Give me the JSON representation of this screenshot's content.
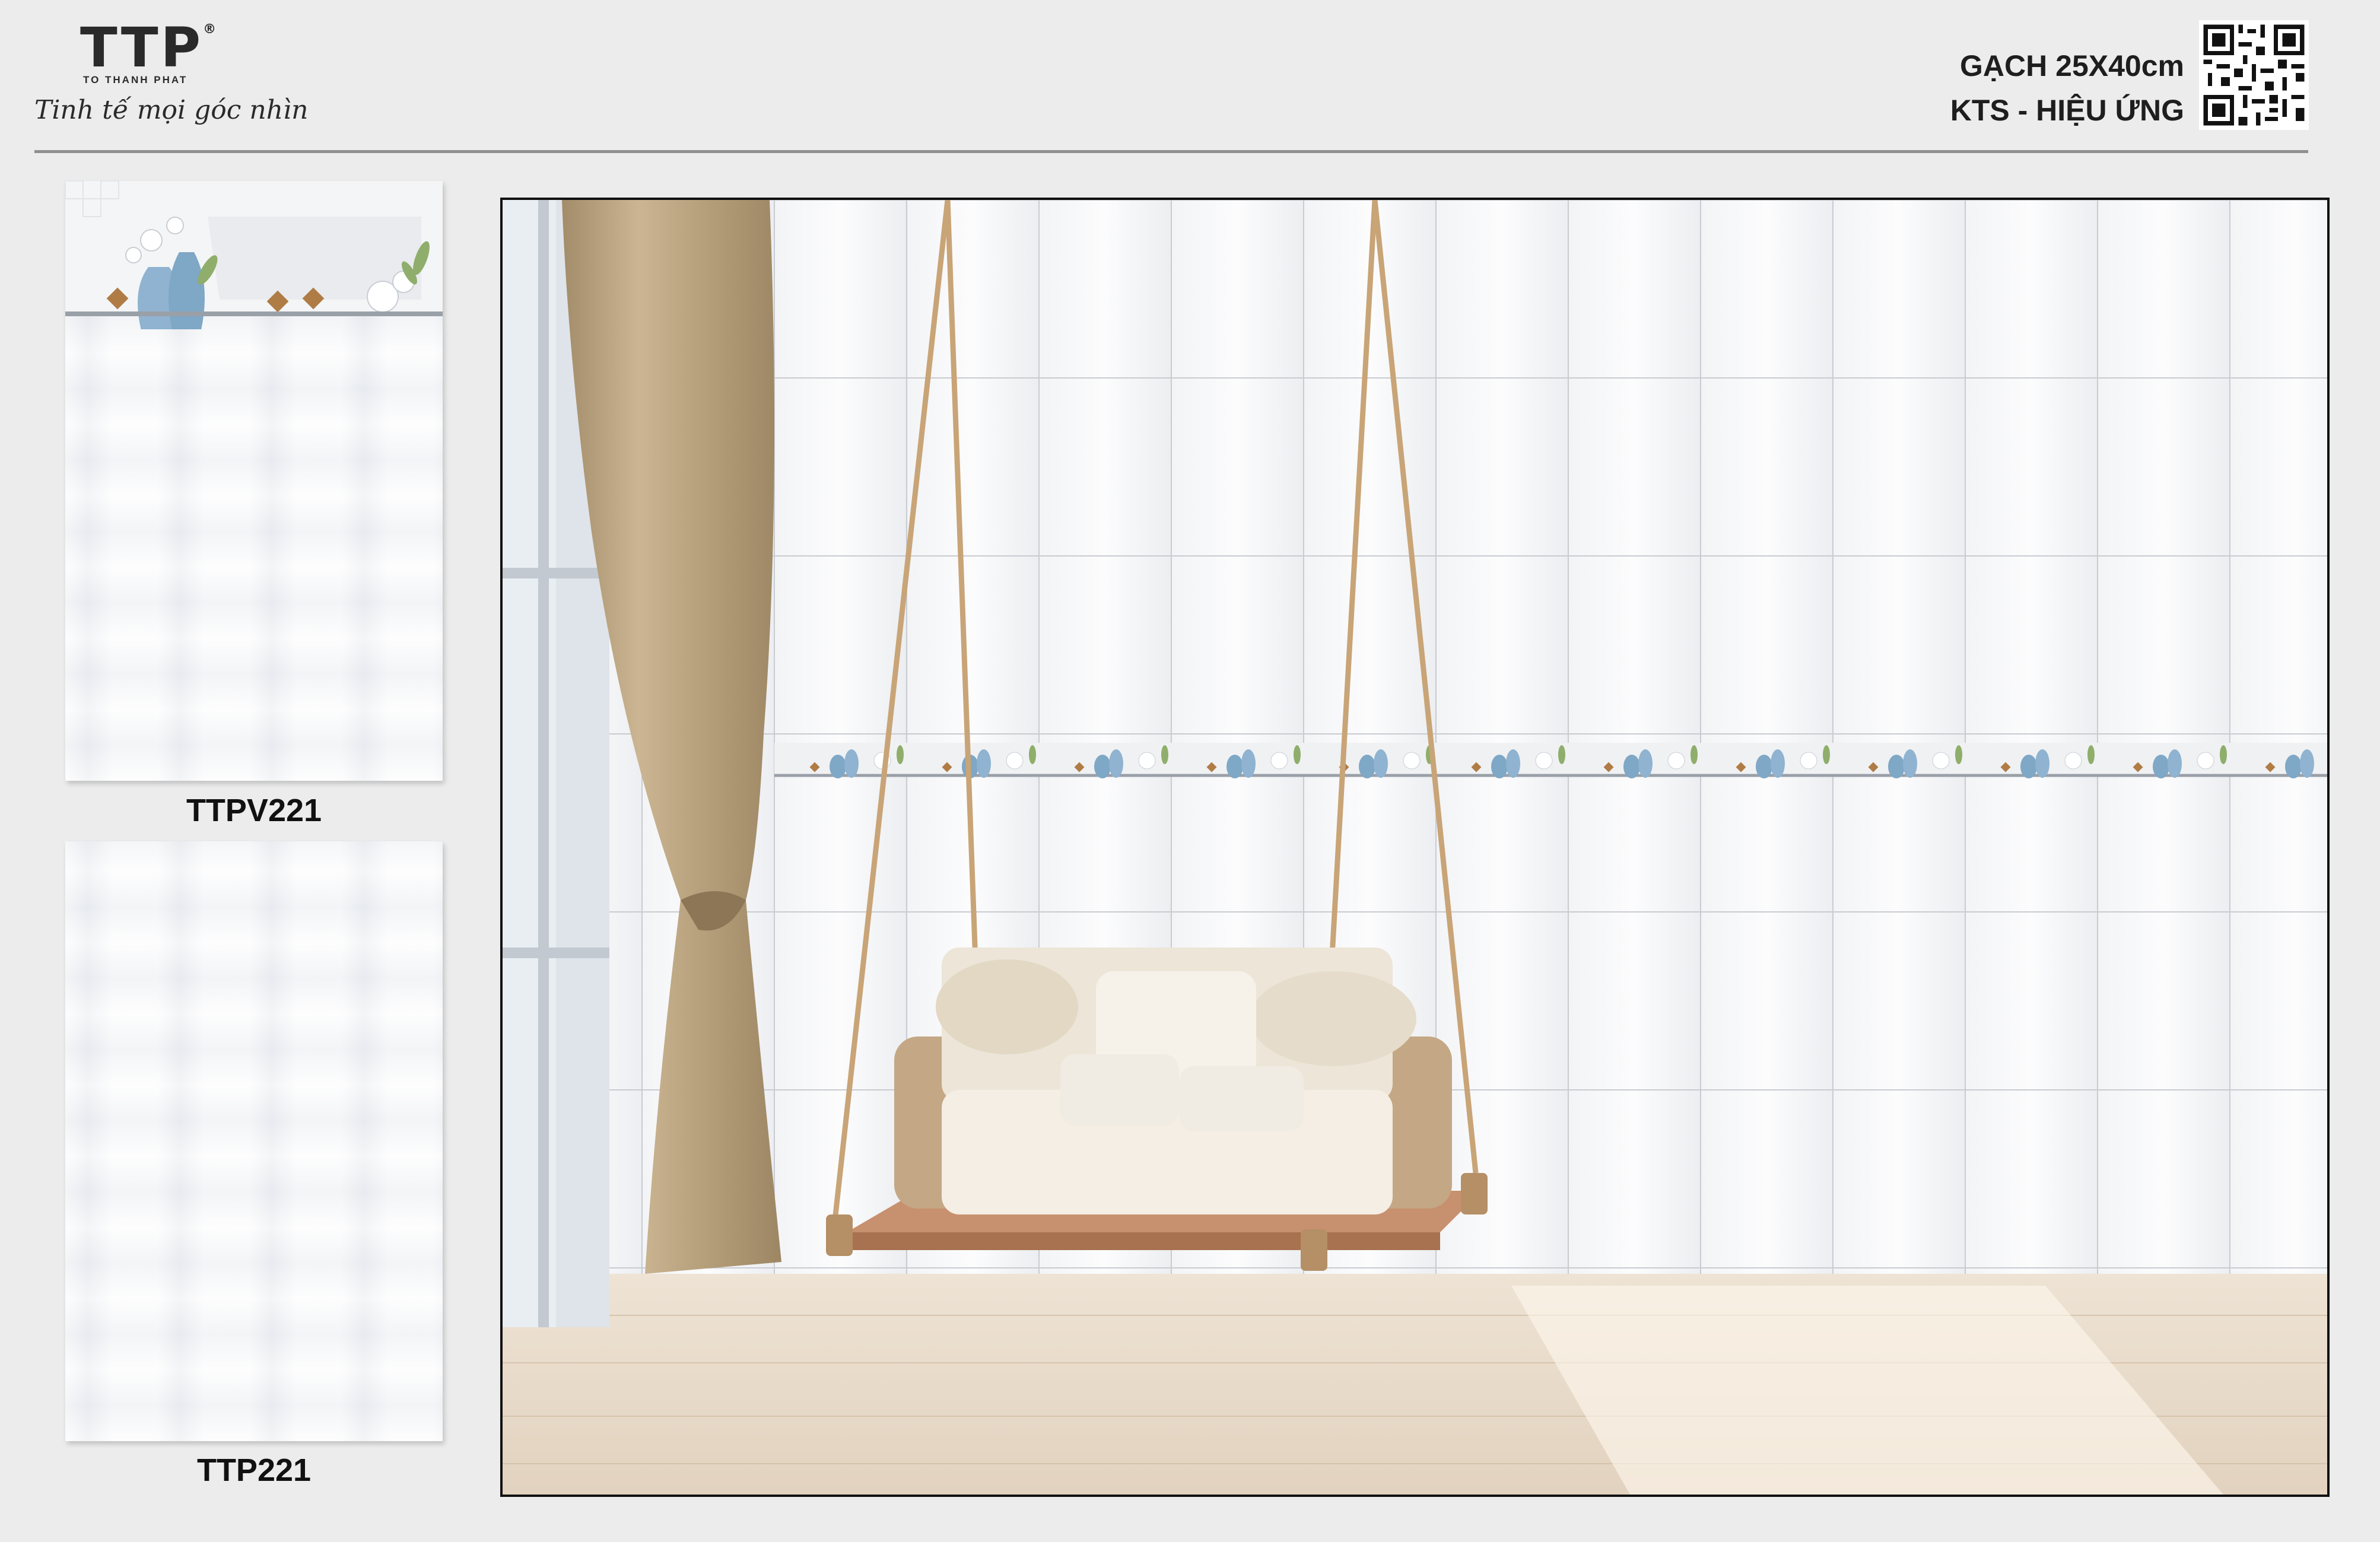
{
  "brand": {
    "logo_text": "TTP",
    "logo_mark": "®",
    "company": "TO THANH PHAT",
    "slogan": "Tinh tế mọi góc nhìn"
  },
  "spec": {
    "size": "GẠCH 25X40cm",
    "type": "KTS - HIỆU ỨNG"
  },
  "tiles": [
    {
      "code": "TTPV221",
      "kind": "border decor tile"
    },
    {
      "code": "TTP221",
      "kind": "plain wave tile"
    }
  ],
  "scene": {
    "icon": "room-preview-image"
  }
}
